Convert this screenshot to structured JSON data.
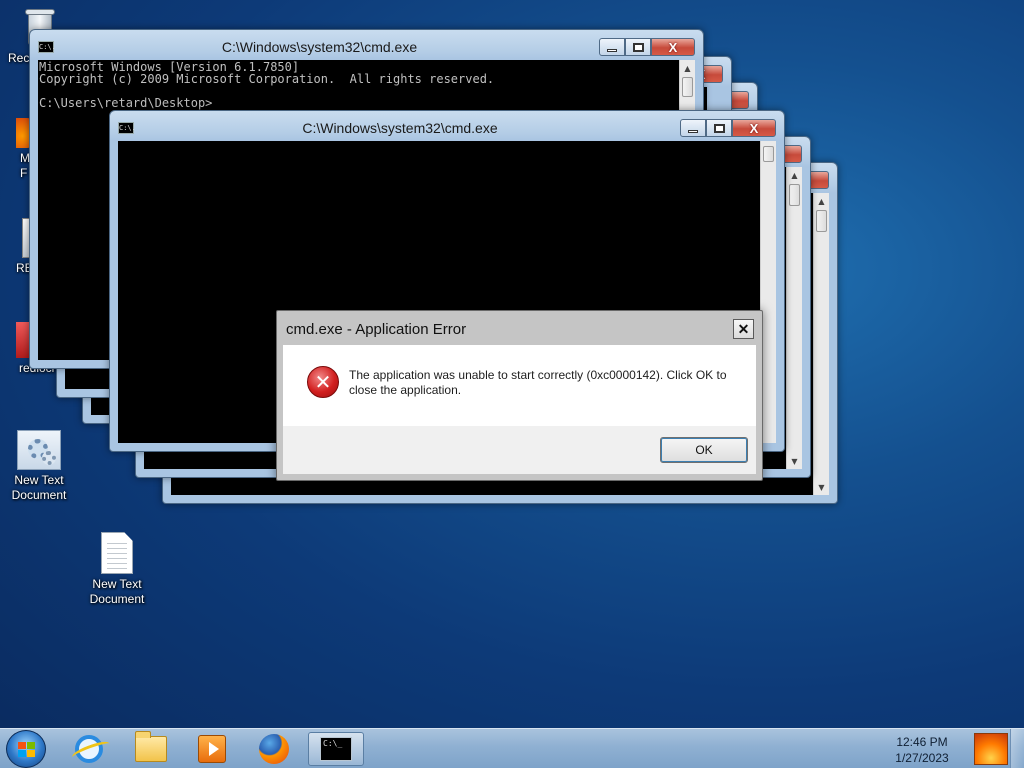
{
  "desktop": {
    "icons": [
      {
        "label": "Rec"
      },
      {
        "label": "M F"
      },
      {
        "label": "RE"
      },
      {
        "label": "redloc"
      },
      {
        "label": "New Text Document"
      },
      {
        "label": "New Text Document"
      }
    ],
    "icon_labels": {
      "recycle": "Rec",
      "mf_1": "M",
      "mf_2": "F",
      "re": "RE",
      "redlock": "redlocl",
      "ntd1_l1": "New Text",
      "ntd1_l2": "Document",
      "ntd2_l1": "New Text",
      "ntd2_l2": "Document"
    }
  },
  "windows": {
    "cmd_front": {
      "title": "C:\\Windows\\system32\\cmd.exe",
      "console_text": "Microsoft Windows [Version 6.1.7850]\nCopyright (c) 2009 Microsoft Corporation.  All rights reserved.\n\nC:\\Users\\retard\\Desktop>"
    },
    "cmd_second": {
      "title": "C:\\Windows\\system32\\cmd.exe"
    },
    "close_glyph": "X",
    "sysicon_text": "C:\\."
  },
  "dialog": {
    "title": "cmd.exe - Application Error",
    "close_glyph": "✕",
    "message": "The application was unable to start correctly (0xc0000142). Click OK to close the application.",
    "icon_glyph": "✕",
    "ok_label": "OK"
  },
  "taskbar": {
    "clock_time": "12:46 PM",
    "clock_date": "1/27/2023",
    "cmd_icon_text": "C:\\_",
    "items": [
      "start-button",
      "internet-explorer",
      "windows-explorer",
      "windows-media-player",
      "firefox",
      "command-prompt"
    ]
  },
  "colors": {
    "desktop_bg": "#14508f",
    "window_frame": "#b4cde6",
    "close_button": "#c74a3b",
    "console_bg": "#000000",
    "error_icon": "#d21f1f"
  }
}
